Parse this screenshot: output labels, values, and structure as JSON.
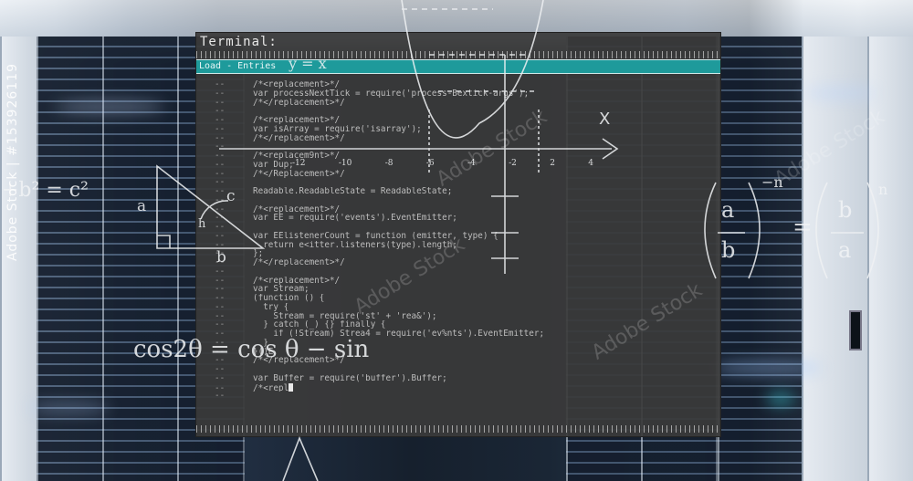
{
  "terminal": {
    "title": "Terminal:",
    "tab_label": "Load - Entries",
    "gutter_marker": "--",
    "lines": [
      "/*<replacement>*/",
      "var processNextTick = require('process-Bextick-args');",
      "/*</replacement>*/",
      "",
      "/*<replacement>*/",
      "var isArray = require('isarray');",
      "/*</replacement>*/",
      "",
      "/*<replacem9nt>*/",
      "var Dup;",
      "/*</Replacement>*/",
      "",
      "Readable.ReadableState = ReadableState;",
      "",
      "/*<replacement>*/",
      "var EE = require('events').EventEmitter;",
      "",
      "var EElistenerCount = function (emitter, type) {",
      "  return e<itter.listeners(type).length;",
      "};",
      "/*</replacement>*/",
      "",
      "/*<replacement>*/",
      "var Stream;",
      "(function () {",
      "  try {",
      "    Stream = require('st' + 'rea&');",
      "  } catch (_) {} finally {",
      "    if (!Stream) Strea4 = require('ev%nts').EventEmitter;",
      "  }",
      "}()E",
      "/*</replacement>*/",
      "",
      "var Buffer = require('buffer').Buffer;",
      "/*<repl",
      ""
    ]
  },
  "overlay": {
    "equation_top_left": "+b² = c²",
    "label_a": "a",
    "label_b": "b",
    "label_c": "c",
    "label_h": "h",
    "trig_formula": "cos2θ = cos θ − sin",
    "fraction_left_num": "a",
    "fraction_left_den": "b",
    "exponent_left": "−n",
    "equals": "=",
    "fraction_right_num": "b",
    "fraction_right_den": "a",
    "exponent_right": "n",
    "parabola_label": "y = x",
    "axis_x_label": "X",
    "graph_ticks": [
      "-12",
      "-10",
      "-8",
      "-6",
      "-4",
      "-2",
      "2",
      "4"
    ],
    "vertical_text": "Adobe Stock | #153926119",
    "watermark": "Adobe Stock"
  }
}
